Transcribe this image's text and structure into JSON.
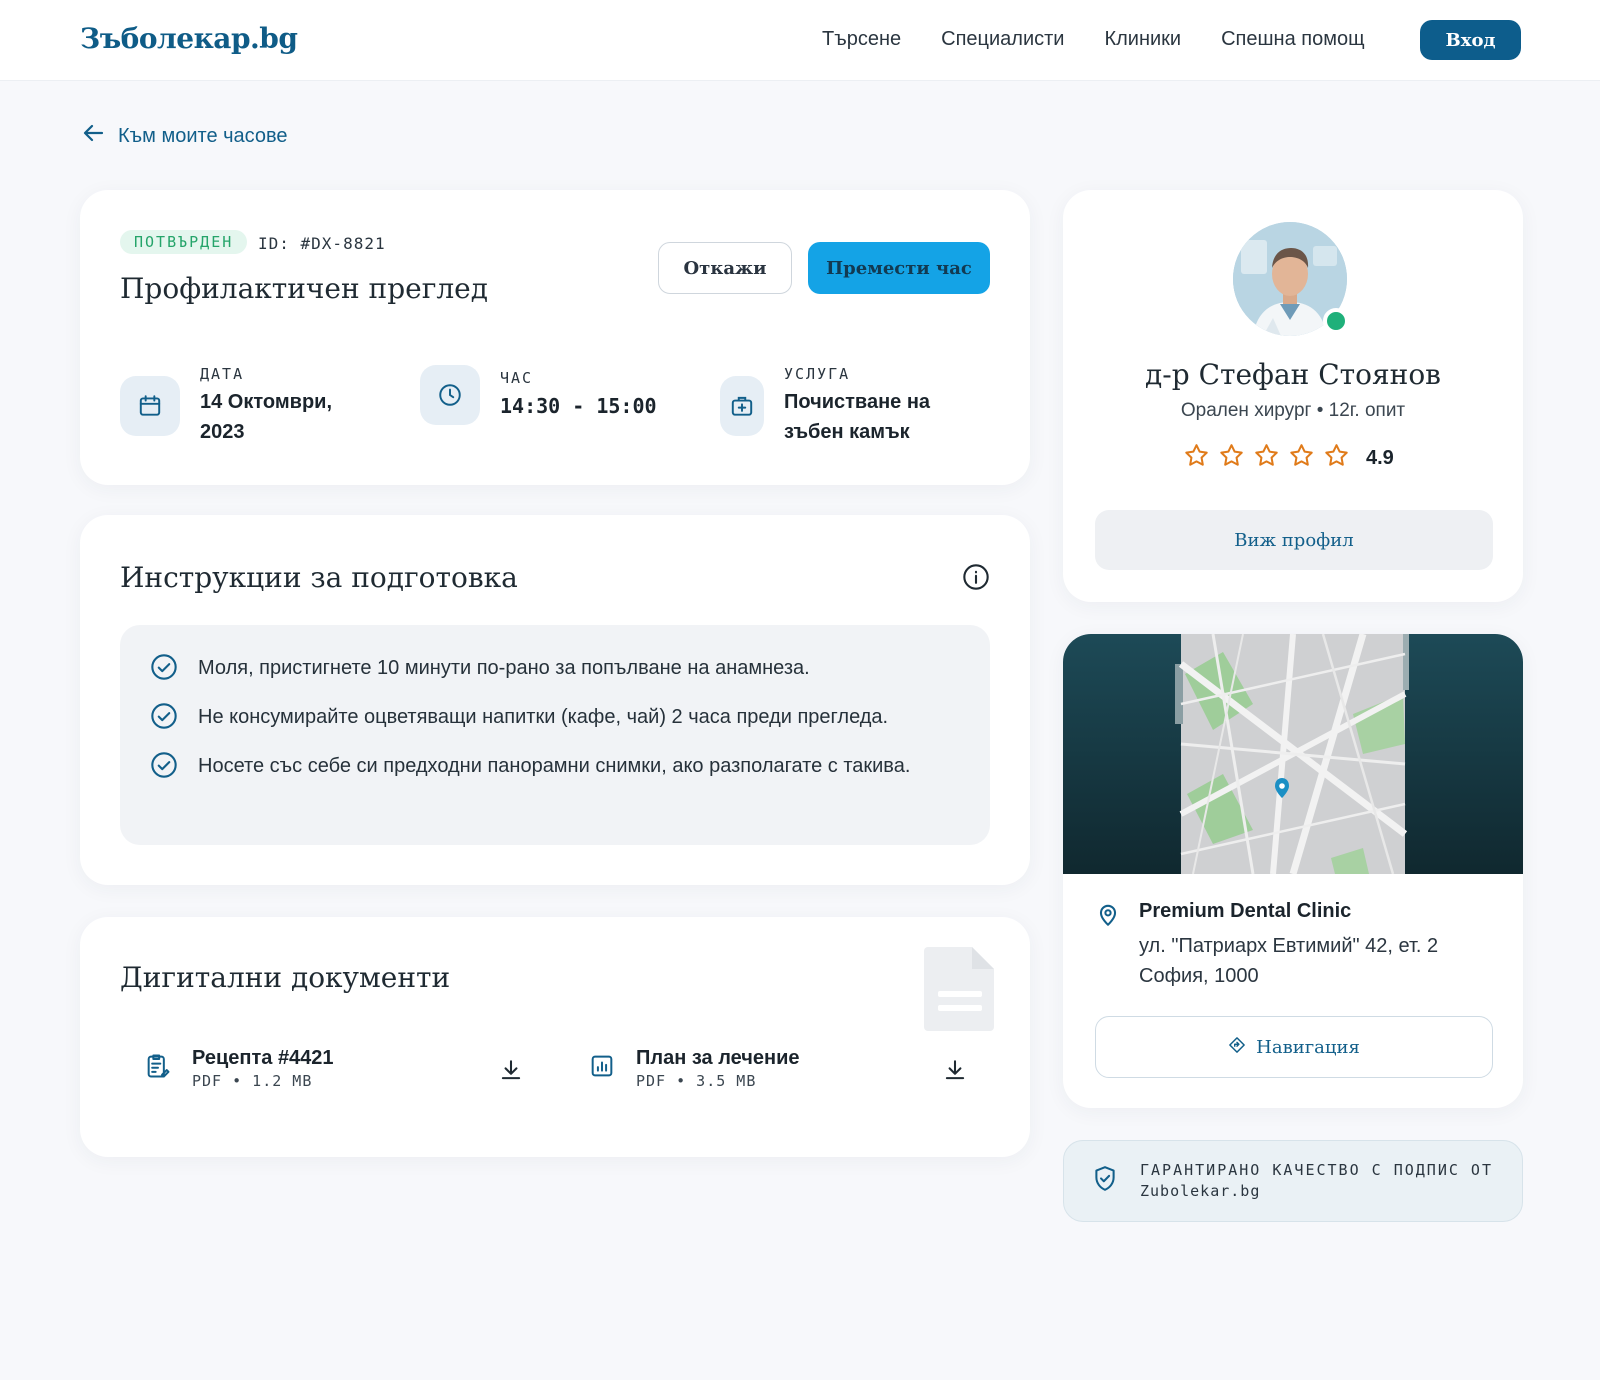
{
  "header": {
    "logo": "Зъболекар.bg",
    "nav": [
      "Търсене",
      "Специалисти",
      "Клиники",
      "Спешна помощ"
    ],
    "login": "Вход"
  },
  "back_link": "Към моите часове",
  "appointment": {
    "status": "ПОТВЪРДЕН",
    "id": "ID: #DX-8821",
    "title": "Профилактичен преглед",
    "cancel_label": "Откажи",
    "move_label": "Премести час",
    "date_label": "ДАТА",
    "date_line1": "14 Октомври,",
    "date_line2": "2023",
    "time_label": "ЧАС",
    "time_value": "14:30 - 15:00",
    "service_label": "УСЛУГА",
    "service_line1": "Почистване на",
    "service_line2": "зъбен камък"
  },
  "instructions": {
    "title": "Инструкции за подготовка",
    "items": [
      "Моля, пристигнете 10 минути по-рано за попълване на анамнеза.",
      "Не консумирайте оцветяващи напитки (кафе, чай) 2 часа преди прегледа.",
      "Носете със себе си предходни панорамни снимки, ако разполагате с такива."
    ]
  },
  "documents": {
    "title": "Дигитални документи",
    "items": [
      {
        "name": "Рецепта #4421",
        "meta": "PDF • 1.2 MB"
      },
      {
        "name": "План за лечение",
        "meta": "PDF • 3.5 MB"
      }
    ]
  },
  "doctor": {
    "name": "д-р Стефан Стоянов",
    "specialty": "Орален хирург • 12г. опит",
    "rating": "4.9",
    "view_profile": "Виж профил"
  },
  "clinic": {
    "name": "Premium Dental Clinic",
    "address_line1": "ул. \"Патриарх Евтимий\" 42, ет. 2",
    "address_line2": "София, 1000",
    "navigation": "Навигация"
  },
  "guarantee": {
    "line1": "ГАРАНТИРАНО КАЧЕСТВО С ПОДПИС ОТ",
    "line2": "Zubolekar.bg"
  },
  "colors": {
    "brand": "#0d5d8c",
    "accent": "#14a3e6",
    "success": "#1fb07a",
    "star": "#e07b1a"
  }
}
